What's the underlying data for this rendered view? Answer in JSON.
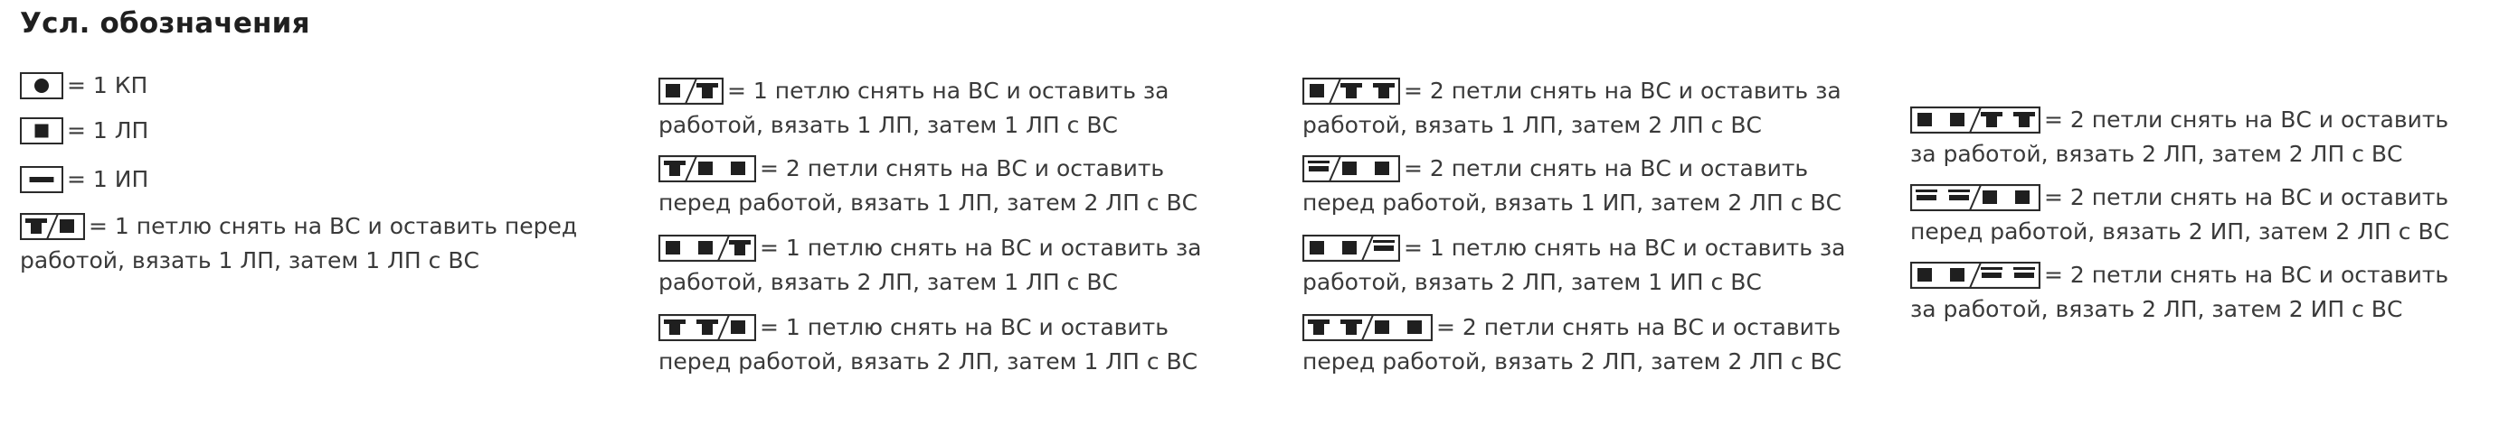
{
  "title": "Усл. обозначения",
  "colors": {
    "stroke": "#2b2b2b",
    "fill": "#1f1f1f",
    "text": "#3a3a3a"
  },
  "legend": [
    {
      "symbol": "kp-icon",
      "line1": "= 1 КП",
      "line2": ""
    },
    {
      "symbol": "lp-icon",
      "line1": "= 1 ЛП",
      "line2": ""
    },
    {
      "symbol": "ip-icon",
      "line1": "= 1 ИП",
      "line2": ""
    },
    {
      "symbol": "cross-1-1-front-icon",
      "line1": "= 1 петлю снять на ВС и оставить перед",
      "line2": "работой, вязать 1 ЛП, затем 1 ЛП с ВС"
    },
    {
      "symbol": "cross-1-1-back-icon",
      "line1": "= 1 петлю снять на ВС и оставить за",
      "line2": "работой, вязать 1 ЛП, затем 1 ЛП с ВС"
    },
    {
      "symbol": "cross-2-1-front-icon",
      "line1": "= 2 петли снять на ВС и оставить",
      "line2": "перед работой, вязать 1 ЛП, затем 2 ЛП с ВС"
    },
    {
      "symbol": "cross-1-2-back-icon",
      "line1": "= 1 петлю снять на ВС и оставить за",
      "line2": "работой, вязать 2 ЛП, затем 1 ЛП с ВС"
    },
    {
      "symbol": "cross-1-2-front-icon",
      "line1": "= 1 петлю снять на ВС и оставить",
      "line2": "перед работой, вязать 2 ЛП, затем 1 ЛП с ВС"
    },
    {
      "symbol": "cross-2-1-back-icon",
      "line1": "= 2 петли снять на ВС и оставить за",
      "line2": "работой, вязать 1 ЛП, затем 2 ЛП с ВС"
    },
    {
      "symbol": "cross-2ip-1-front-icon",
      "line1": "= 2 петли снять на ВС и оставить",
      "line2": "перед работой, вязать 1 ИП, затем 2 ЛП с ВС"
    },
    {
      "symbol": "cross-1ip-2-back-icon",
      "line1": "= 1 петлю снять на ВС и оставить за",
      "line2": "работой, вязать 2 ЛП, затем 1 ИП с ВС"
    },
    {
      "symbol": "cross-2-2-front-icon",
      "line1": "= 2 петли снять на ВС и оставить",
      "line2": "перед работой, вязать 2 ЛП, затем 2 ЛП с ВС"
    },
    {
      "symbol": "cross-2-2-back-icon",
      "line1": "= 2 петли снять на ВС и оставить",
      "line2": "за работой, вязать 2 ЛП, затем 2 ЛП с ВС"
    },
    {
      "symbol": "cross-2ip-2-front-icon",
      "line1": "= 2 петли снять на ВС и оставить",
      "line2": "перед работой, вязать 2 ИП, затем 2 ЛП с ВС"
    },
    {
      "symbol": "cross-2-2ip-back-icon",
      "line1": "= 2 петли снять на ВС и оставить",
      "line2": "за работой, вязать 2 ЛП, затем 2 ИП с ВС"
    }
  ]
}
